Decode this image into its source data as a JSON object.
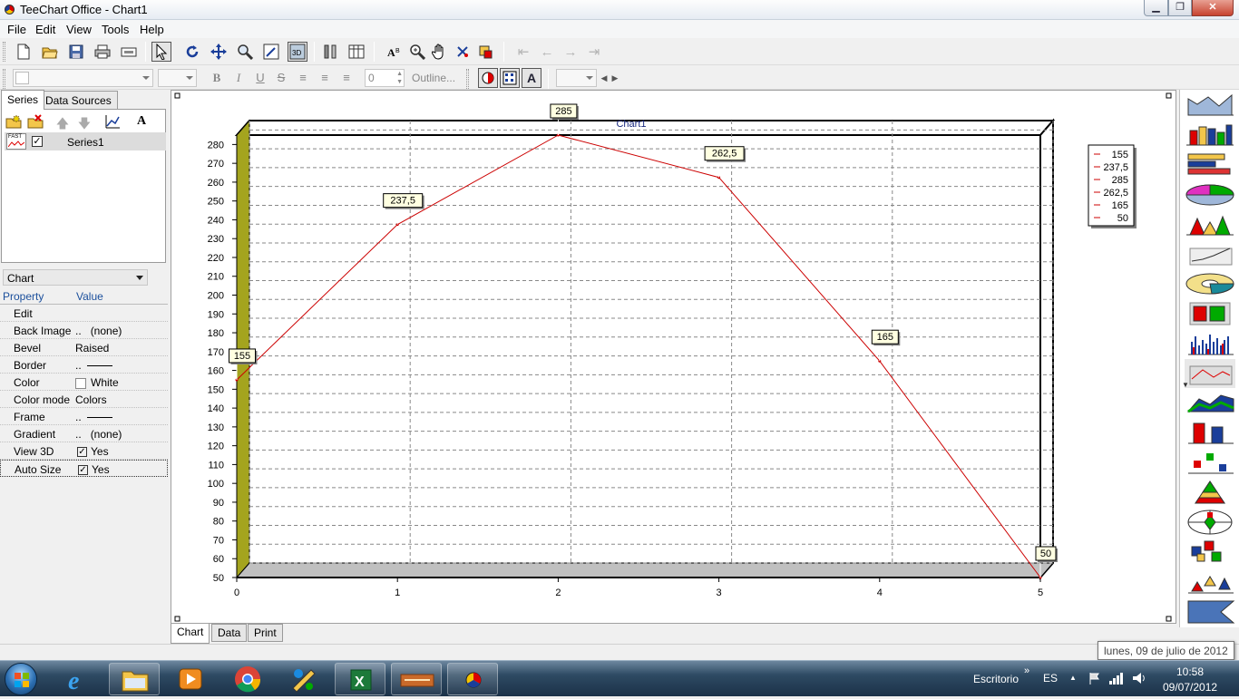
{
  "window": {
    "title": "TeeChart Office - Chart1",
    "min_glyph": "▁",
    "max_glyph": "❐",
    "close_glyph": "✕"
  },
  "menu": [
    "File",
    "Edit",
    "View",
    "Tools",
    "Help"
  ],
  "toolbar2": {
    "font_size_value": "0",
    "outline_label": "Outline..."
  },
  "left_panel": {
    "tabs": [
      "Series",
      "Data Sources"
    ],
    "series": [
      {
        "name": "Series1",
        "checked": "✓",
        "thumb_text": "FAST"
      }
    ],
    "chart_combo": "Chart",
    "property_header": "Property",
    "value_header": "Value",
    "properties": [
      {
        "name": "Edit",
        "value": ""
      },
      {
        "name": "Back Image",
        "value": "(none)"
      },
      {
        "name": "Bevel",
        "value": "Raised"
      },
      {
        "name": "Border",
        "value": ""
      },
      {
        "name": "Color",
        "value": "White"
      },
      {
        "name": "Color mode",
        "value": "Colors"
      },
      {
        "name": "Frame",
        "value": ""
      },
      {
        "name": "Gradient",
        "value": "(none)"
      },
      {
        "name": "View 3D",
        "value": "Yes"
      },
      {
        "name": "Auto Size",
        "value": "Yes"
      }
    ],
    "ellipsis": "..",
    "check_mark": "✓"
  },
  "chart_data": {
    "type": "line",
    "title": "Chart1",
    "x": [
      0,
      1,
      2,
      3,
      4,
      5
    ],
    "series": [
      {
        "values": [
          155,
          237.5,
          285,
          262.5,
          165,
          50
        ],
        "color": "#cc0000"
      }
    ],
    "point_labels": [
      "155",
      "237,5",
      "285",
      "262,5",
      "165",
      "50"
    ],
    "x_ticks": [
      "0",
      "1",
      "2",
      "3",
      "4",
      "5"
    ],
    "ylim": [
      50,
      285
    ],
    "y_ticks": [
      50,
      60,
      70,
      80,
      90,
      100,
      110,
      120,
      130,
      140,
      150,
      160,
      170,
      180,
      190,
      200,
      210,
      220,
      230,
      240,
      250,
      260,
      270,
      280
    ],
    "legend": [
      "155",
      "237,5",
      "285",
      "262,5",
      "165",
      "50"
    ],
    "legend_position": "top-right",
    "view_3d": true,
    "wall_color": "#a4a41e",
    "floor_color": "#c0c0c0",
    "grid": true
  },
  "bottom_tabs": [
    "Chart",
    "Data",
    "Print"
  ],
  "taskbar": {
    "desktop_label": "Escritorio",
    "desktop_arrows": "»",
    "language": "ES",
    "tray_arrow": "▲",
    "time": "10:58",
    "date": "09/07/2012",
    "date_tooltip": "lunes, 09 de julio de 2012"
  }
}
